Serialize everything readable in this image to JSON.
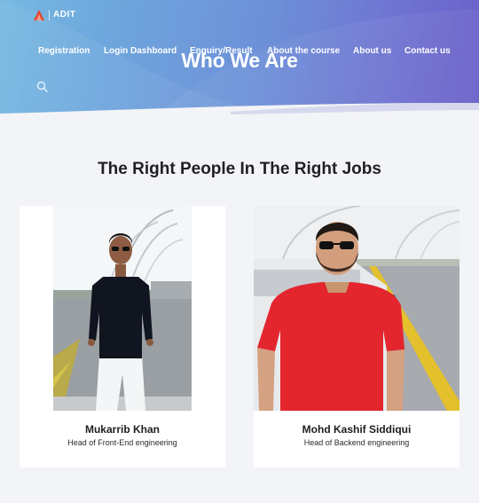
{
  "header": {
    "logo_text": "ADIT",
    "nav": [
      {
        "label": "Registration"
      },
      {
        "label": "Login Dashboard"
      },
      {
        "label": "Enquiry/Result"
      },
      {
        "label": "About the course"
      },
      {
        "label": "About us"
      },
      {
        "label": "Contact us"
      }
    ],
    "search_icon": "search-icon",
    "hero_title": "Who We Are"
  },
  "main": {
    "section_title": "The Right People In The Right Jobs",
    "team": [
      {
        "name": "Mukarrib Khan",
        "role": "Head of Front-End engineering"
      },
      {
        "name": "Mohd Kashif Siddiqui",
        "role": "Head of Backend engineering"
      }
    ]
  },
  "colors": {
    "hero_gradient_start": "#76b9e2",
    "hero_gradient_end": "#6a5fc9",
    "page_background": "#f3f4f7",
    "card_background": "#ffffff",
    "logo_accent": "#e8452c"
  }
}
